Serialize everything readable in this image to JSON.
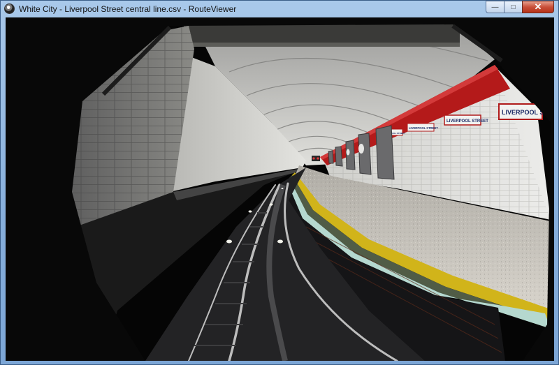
{
  "window": {
    "title": "White City - Liverpool Street central line.csv - RouteViewer",
    "minimize_glyph": "—",
    "maximize_glyph": "□",
    "close_glyph": "✕"
  },
  "viewport": {
    "signs": [
      "LIVERPOOL ST",
      "LIVERPOOL STREET",
      "LIVERPOOL STREET",
      "LIVERPOOL STREET"
    ]
  }
}
